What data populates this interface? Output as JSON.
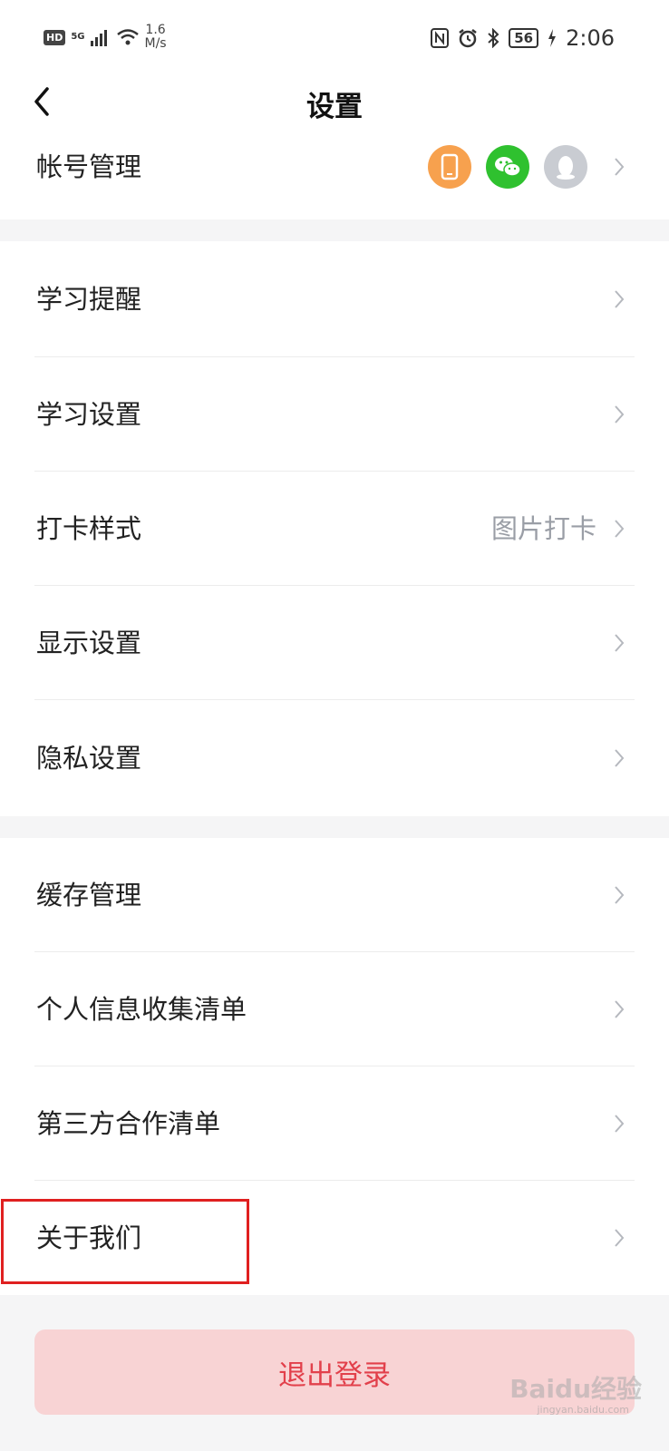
{
  "status_bar": {
    "hd": "HD",
    "network": "5G",
    "speed_value": "1.6",
    "speed_unit": "M/s",
    "battery": "56",
    "time": "2:06"
  },
  "nav": {
    "title": "设置"
  },
  "account": {
    "label": "帐号管理",
    "bound_icons": [
      "phone-icon",
      "wechat-icon",
      "qq-icon"
    ],
    "colors": {
      "phone": "#f7a14e",
      "wechat": "#2fc12f",
      "qq": "#c9ccd2"
    }
  },
  "sections": [
    {
      "items": [
        {
          "label": "学习提醒"
        },
        {
          "label": "学习设置"
        },
        {
          "label": "打卡样式",
          "value": "图片打卡"
        },
        {
          "label": "显示设置"
        },
        {
          "label": "隐私设置"
        }
      ]
    },
    {
      "items": [
        {
          "label": "缓存管理"
        },
        {
          "label": "个人信息收集清单"
        },
        {
          "label": "第三方合作清单"
        },
        {
          "label": "关于我们"
        }
      ]
    }
  ],
  "logout": {
    "label": "退出登录",
    "bg_color": "#f8d3d4",
    "text_color": "#e2404b"
  },
  "watermark": {
    "text": "Baidu经验",
    "sub": "jingyan.baidu.com"
  }
}
